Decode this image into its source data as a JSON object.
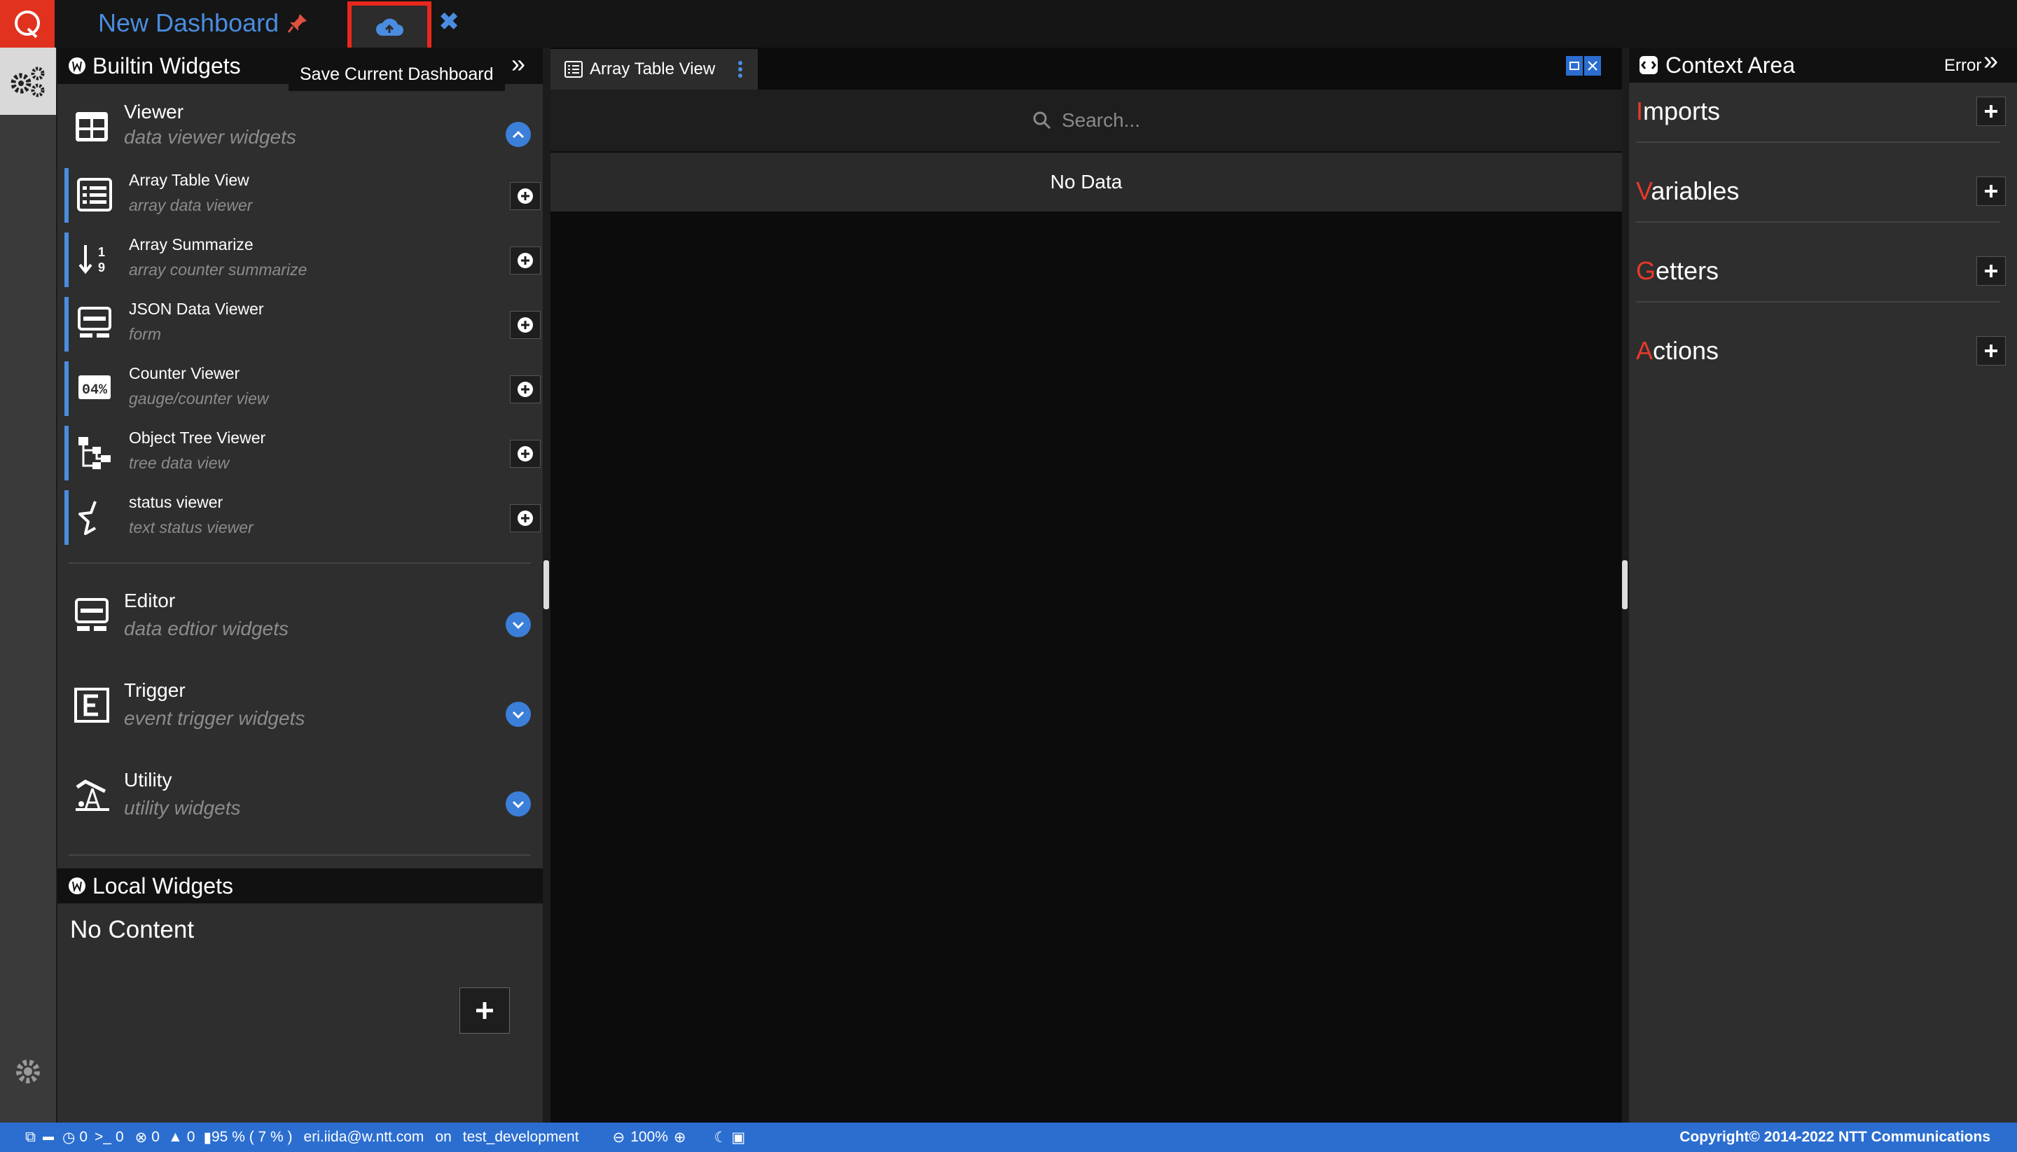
{
  "header": {
    "title": "New Dashboard",
    "tooltip": "Save Current Dashboard"
  },
  "builtin": {
    "title": "Builtin Widgets",
    "hidden_text": "ts",
    "categories": [
      {
        "title": "Viewer",
        "subtitle": "data viewer widgets"
      },
      {
        "title": "Editor",
        "subtitle": "data edtior widgets"
      },
      {
        "title": "Trigger",
        "subtitle": "event trigger widgets"
      },
      {
        "title": "Utility",
        "subtitle": "utility widgets"
      }
    ],
    "widgets": [
      {
        "title": "Array Table View",
        "subtitle": "array data viewer",
        "icon": "table-list-icon"
      },
      {
        "title": "Array Summarize",
        "subtitle": "array counter summarize",
        "icon": "sort-numeric-icon"
      },
      {
        "title": "JSON Data Viewer",
        "subtitle": "form",
        "icon": "form-icon"
      },
      {
        "title": "Counter Viewer",
        "subtitle": "gauge/counter view",
        "icon": "counter-icon"
      },
      {
        "title": "Object Tree Viewer",
        "subtitle": "tree data view",
        "icon": "tree-icon"
      },
      {
        "title": "status viewer",
        "subtitle": "text status viewer",
        "icon": "star-half-icon"
      }
    ]
  },
  "local": {
    "title": "Local Widgets",
    "empty": "No Content"
  },
  "center": {
    "tab_label": "Array Table View",
    "search_placeholder": "Search...",
    "empty": "No Data"
  },
  "context": {
    "title": "Context Area",
    "error_label": "Error",
    "items": [
      {
        "first": "I",
        "rest": "mports"
      },
      {
        "first": "V",
        "rest": "ariables"
      },
      {
        "first": "G",
        "rest": "etters"
      },
      {
        "first": "A",
        "rest": "ctions"
      }
    ]
  },
  "status": {
    "info": "0",
    "terminal": "0",
    "errors": "0",
    "warnings": "0",
    "memory": "95 % ( 7 % )",
    "user": "eri.iida@w.ntt.com",
    "on": "on",
    "env": "test_development",
    "zoom": "100%",
    "copyright": "Copyright© 2014-2022 NTT Communications"
  },
  "colors": {
    "accent": "#4a8de0",
    "brand": "#e0321e",
    "status_bar": "#2b6ed0"
  }
}
